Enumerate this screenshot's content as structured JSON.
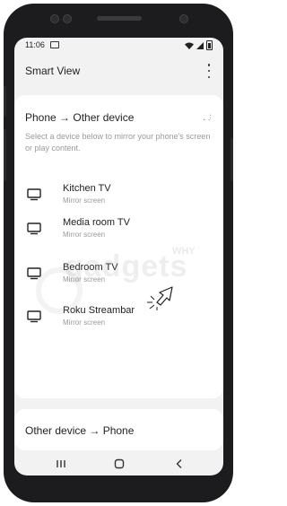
{
  "status_bar": {
    "time": "11:06"
  },
  "app_bar": {
    "title": "Smart View"
  },
  "section_top": {
    "heading": "Phone → Other device",
    "description": "Select a device below to mirror your phone's screen or play content."
  },
  "devices": [
    {
      "name": "Kitchen TV",
      "subtitle": "Mirror screen"
    },
    {
      "name": "Media room TV",
      "subtitle": "Mirror screen"
    },
    {
      "name": "Bedroom TV",
      "subtitle": "Mirror screen"
    },
    {
      "name": "Roku Streambar",
      "subtitle": "Mirror screen"
    }
  ],
  "section_bottom": {
    "label": "Other device → Phone"
  },
  "watermark": {
    "text": "gadgets",
    "sub": "WHY"
  },
  "icons": {
    "more": "more-vert-icon",
    "tv": "tv-icon",
    "recent": "recent-apps-icon",
    "home": "home-icon",
    "back": "back-icon"
  },
  "colors": {
    "frame": "#1c1c1e",
    "background": "#f2f2f2",
    "card": "#ffffff",
    "secondary_text": "#9a9a9a"
  }
}
